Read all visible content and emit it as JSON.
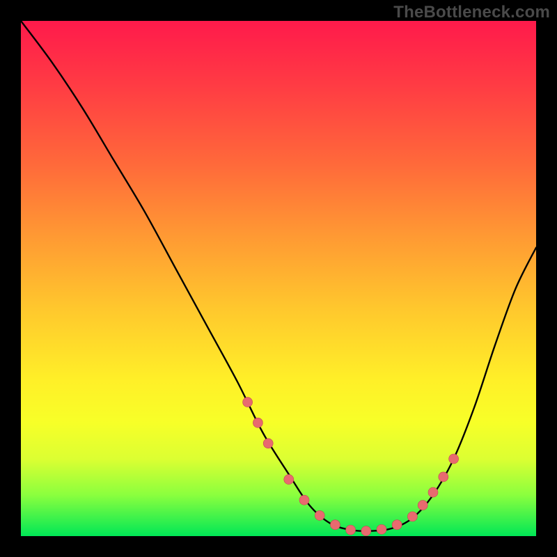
{
  "attribution": "TheBottleneck.com",
  "colors": {
    "page_bg": "#000000",
    "gradient_top": "#ff1a4b",
    "gradient_bottom": "#00e756",
    "curve": "#000000",
    "marker_fill": "#e86a6f",
    "marker_stroke": "#c24a50"
  },
  "chart_data": {
    "type": "line",
    "title": "",
    "xlabel": "",
    "ylabel": "",
    "xlim": [
      0,
      100
    ],
    "ylim": [
      0,
      100
    ],
    "grid": false,
    "series": [
      {
        "name": "bottleneck-curve",
        "x": [
          0,
          6,
          12,
          18,
          24,
          30,
          36,
          42,
          47,
          52,
          56,
          60,
          64,
          68,
          72,
          76,
          80,
          84,
          88,
          92,
          96,
          100
        ],
        "y": [
          100,
          92,
          83,
          73,
          63,
          52,
          41,
          30,
          20,
          12,
          6,
          2.5,
          1.2,
          1.0,
          1.5,
          3.5,
          8,
          15,
          25,
          37,
          48,
          56
        ]
      }
    ],
    "markers": {
      "name": "highlight-points",
      "x": [
        44,
        46,
        48,
        52,
        55,
        58,
        61,
        64,
        67,
        70,
        73,
        76,
        78,
        80,
        82,
        84
      ],
      "y": [
        26,
        22,
        18,
        11,
        7,
        4,
        2.2,
        1.2,
        1.0,
        1.3,
        2.2,
        3.8,
        6,
        8.5,
        11.5,
        15
      ]
    }
  }
}
